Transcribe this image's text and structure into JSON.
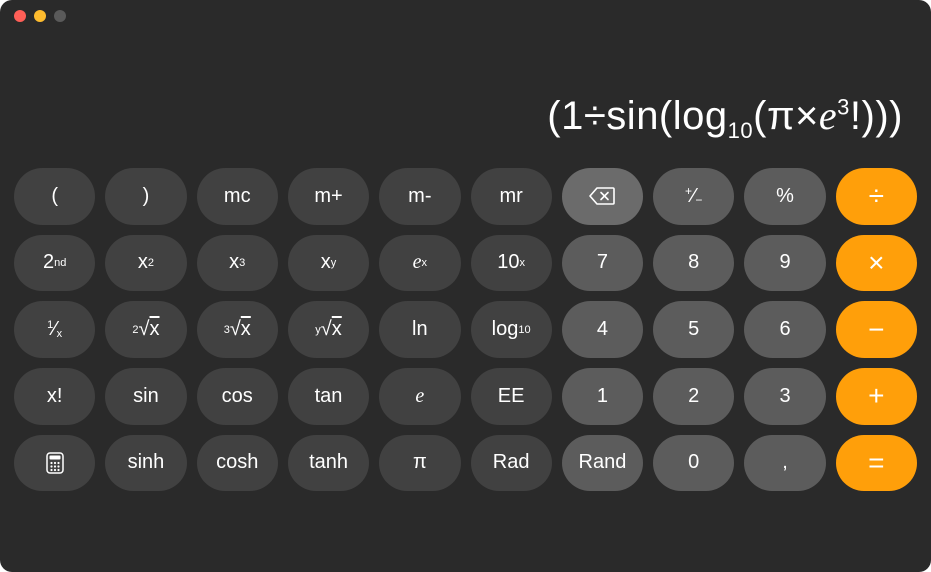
{
  "display": {
    "expression_html": "(1÷sin(log<sub>10</sub>(π×<span class='ital'>e</span><sup>3</sup>!)))"
  },
  "rows": [
    [
      {
        "name": "open-paren-button",
        "class": "dark",
        "label": "("
      },
      {
        "name": "close-paren-button",
        "class": "dark",
        "label": ")"
      },
      {
        "name": "memory-clear-button",
        "class": "dark",
        "label": "mc"
      },
      {
        "name": "memory-add-button",
        "class": "dark",
        "label": "m+"
      },
      {
        "name": "memory-subtract-button",
        "class": "dark",
        "label": "m-"
      },
      {
        "name": "memory-recall-button",
        "class": "dark",
        "label": "mr"
      },
      {
        "name": "backspace-button",
        "class": "active-light",
        "icon": "backspace"
      },
      {
        "name": "sign-toggle-button",
        "class": "light",
        "label_html": "<span style='font-size:12px;position:relative;top:-5px'>+</span>⁄<span style='font-size:12px;position:relative;top:4px'>−</span>"
      },
      {
        "name": "percent-button",
        "class": "light",
        "label": "%"
      },
      {
        "name": "divide-button",
        "class": "orange op",
        "label": "÷"
      }
    ],
    [
      {
        "name": "second-function-button",
        "class": "dark",
        "label_html": "2<sup>nd</sup>"
      },
      {
        "name": "square-button",
        "class": "dark",
        "label_html": "x<sup>2</sup>"
      },
      {
        "name": "cube-button",
        "class": "dark",
        "label_html": "x<sup>3</sup>"
      },
      {
        "name": "power-button",
        "class": "dark",
        "label_html": "x<sup>y</sup>"
      },
      {
        "name": "e-to-x-button",
        "class": "dark",
        "label_html": "<span class='ital'>e</span><sup>x</sup>"
      },
      {
        "name": "ten-to-x-button",
        "class": "dark",
        "label_html": "10<sup>x</sup>"
      },
      {
        "name": "seven-button",
        "class": "light",
        "label": "7"
      },
      {
        "name": "eight-button",
        "class": "light",
        "label": "8"
      },
      {
        "name": "nine-button",
        "class": "light",
        "label": "9"
      },
      {
        "name": "multiply-button",
        "class": "orange op",
        "label": "×"
      }
    ],
    [
      {
        "name": "reciprocal-button",
        "class": "dark",
        "label_html": "<span style='font-size:11px;position:relative;top:-5px'>1</span>⁄<span style='font-size:11px;position:relative;top:4px'>x</span>"
      },
      {
        "name": "square-root-button",
        "class": "dark",
        "label_html": "<sup>2</sup>√<span style='text-decoration:overline'>x</span>"
      },
      {
        "name": "cube-root-button",
        "class": "dark",
        "label_html": "<sup>3</sup>√<span style='text-decoration:overline'>x</span>"
      },
      {
        "name": "y-root-button",
        "class": "dark",
        "label_html": "<sup>y</sup>√<span style='text-decoration:overline'>x</span>"
      },
      {
        "name": "natural-log-button",
        "class": "dark",
        "label": "ln"
      },
      {
        "name": "log10-button",
        "class": "dark",
        "label_html": "log<sub>10</sub>"
      },
      {
        "name": "four-button",
        "class": "light",
        "label": "4"
      },
      {
        "name": "five-button",
        "class": "light",
        "label": "5"
      },
      {
        "name": "six-button",
        "class": "light",
        "label": "6"
      },
      {
        "name": "subtract-button",
        "class": "orange op",
        "label": "−"
      }
    ],
    [
      {
        "name": "factorial-button",
        "class": "dark",
        "label": "x!"
      },
      {
        "name": "sin-button",
        "class": "dark",
        "label": "sin"
      },
      {
        "name": "cos-button",
        "class": "dark",
        "label": "cos"
      },
      {
        "name": "tan-button",
        "class": "dark",
        "label": "tan"
      },
      {
        "name": "e-constant-button",
        "class": "dark",
        "label_html": "<span class='ital'>e</span>"
      },
      {
        "name": "ee-button",
        "class": "dark",
        "label": "EE"
      },
      {
        "name": "one-button",
        "class": "light",
        "label": "1"
      },
      {
        "name": "two-button",
        "class": "light",
        "label": "2"
      },
      {
        "name": "three-button",
        "class": "light",
        "label": "3"
      },
      {
        "name": "add-button",
        "class": "orange op",
        "label": "+"
      }
    ],
    [
      {
        "name": "calculator-mode-button",
        "class": "dark",
        "icon": "calculator"
      },
      {
        "name": "sinh-button",
        "class": "dark",
        "label": "sinh"
      },
      {
        "name": "cosh-button",
        "class": "dark",
        "label": "cosh"
      },
      {
        "name": "tanh-button",
        "class": "dark",
        "label": "tanh"
      },
      {
        "name": "pi-button",
        "class": "dark",
        "label": "π"
      },
      {
        "name": "rad-button",
        "class": "dark",
        "label": "Rad"
      },
      {
        "name": "rand-button",
        "class": "light",
        "label": "Rand"
      },
      {
        "name": "zero-button",
        "class": "light",
        "label": "0"
      },
      {
        "name": "decimal-button",
        "class": "light",
        "label": ","
      },
      {
        "name": "equals-button",
        "class": "orange op",
        "label": "="
      }
    ]
  ]
}
